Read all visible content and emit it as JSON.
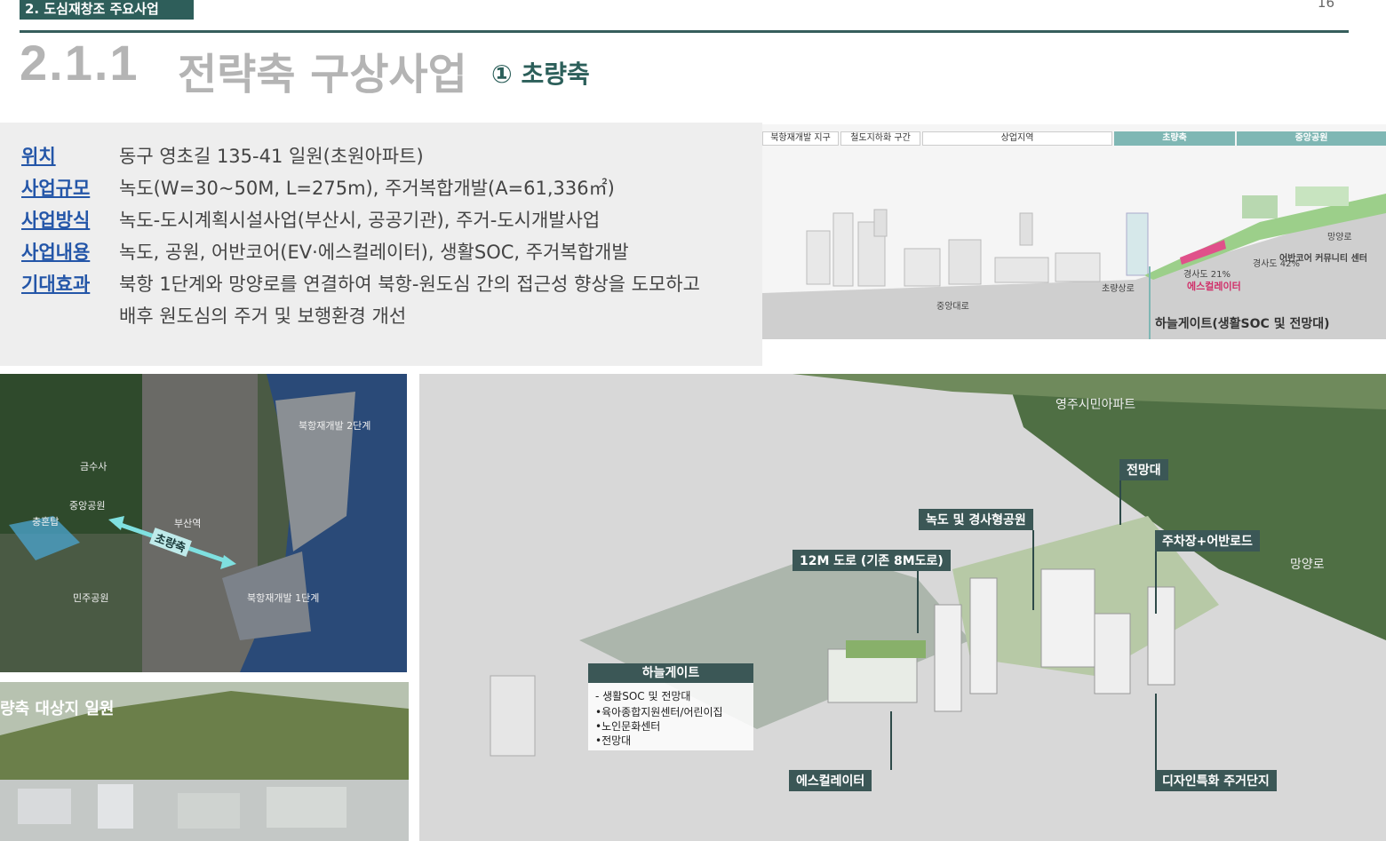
{
  "header": {
    "section_badge": "2. 도심재창조 주요사업",
    "page_number": "16",
    "title_number": "2.1.1",
    "title_text": "전략축 구상사업",
    "subtitle": "① 초량축"
  },
  "info": [
    {
      "label": "위치",
      "value": "동구 영초길 135-41 일원(초원아파트)"
    },
    {
      "label": "사업규모",
      "value": "녹도(W=30~50M, L=275m), 주거복합개발(A=61,336㎡)"
    },
    {
      "label": "사업방식",
      "value": "녹도-도시계획시설사업(부산시, 공공기관), 주거-도시개발사업"
    },
    {
      "label": "사업내용",
      "value": "녹도, 공원, 어반코어(EV·에스컬레이터), 생활SOC, 주거복합개발"
    },
    {
      "label": "기대효과",
      "value": "북항 1단계와 망양로를 연결하여 북항-원도심 간의 접근성 향상을 도모하고"
    },
    {
      "label": "",
      "value": "배후 원도심의 주거 및 보행환경 개선"
    }
  ],
  "section_diagram": {
    "zones": [
      "북항재개발 지구",
      "철도지하화 구간",
      "상업지역",
      "초량축",
      "중앙공원"
    ],
    "labels": {
      "road_central": "중앙대로",
      "road_choryang": "초량상로",
      "road_mangyang": "망양로",
      "slope_1": "경사도 21%",
      "slope_2": "경사도 42%",
      "urban_core": "어반코어 커뮤니티 센터",
      "escalator": "에스컬레이터",
      "sky_gate": "하늘게이트(생활SOC 및 전망대)"
    }
  },
  "map": {
    "labels": [
      "북항재개발 2단계",
      "금수사",
      "중앙공원",
      "충혼탑",
      "부산역",
      "민주공원",
      "북항재개발 1단계"
    ],
    "axis_label": "초량축"
  },
  "aerial": {
    "title": "량축 대상지 일원"
  },
  "render": {
    "callouts": [
      "녹도 및 경사형공원",
      "전망대",
      "주차장+어반로드",
      "12M 도로 (기존 8M도로)",
      "에스컬레이터",
      "디자인특화 주거단지"
    ],
    "plain_labels": [
      "영주시민아파트",
      "망양로"
    ],
    "sky_gate": {
      "title": "하늘게이트",
      "items": [
        "- 생활SOC 및 전망대",
        "•육아종합지원센터/어린이집",
        "•노인문화센터",
        "•전망대"
      ]
    }
  },
  "colors": {
    "badge": "#2e5e5a",
    "rule": "#365e5c",
    "title_gray": "#b4b4b4",
    "label_blue": "#2456a8",
    "teal": "#7fb7b4",
    "callout": "#3b5756",
    "accent_pink": "#d0306a"
  }
}
